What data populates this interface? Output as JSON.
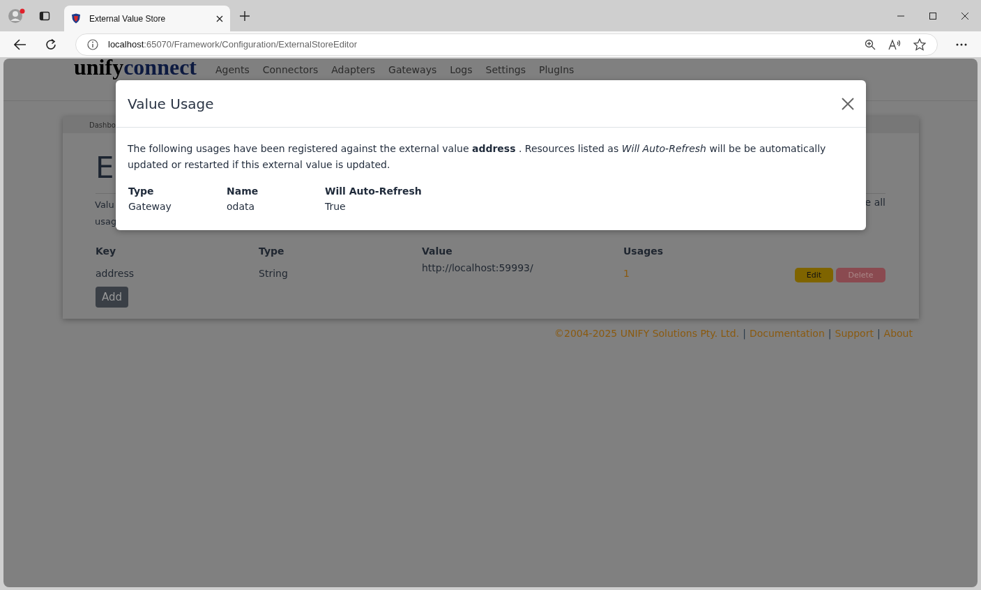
{
  "browser": {
    "tab_title": "External Value Store",
    "address_host": "localhost",
    "address_path": ":65070/Framework/Configuration/ExternalStoreEditor"
  },
  "page": {
    "logo": [
      "unify",
      "connect"
    ],
    "nav": [
      "Agents",
      "Connectors",
      "Adapters",
      "Gateways",
      "Logs",
      "Settings",
      "PlugIns"
    ],
    "breadcrumb": "Dashbo",
    "heading": "E",
    "intro_left": [
      "Valu",
      "usag"
    ],
    "intro_right": "e all",
    "table": {
      "columns": [
        "Key",
        "Type",
        "Value",
        "Usages"
      ],
      "rows": [
        {
          "key": "address",
          "type": "String",
          "value": "http://localhost:59993/",
          "usages": "1",
          "actions": [
            "Edit",
            "Delete"
          ]
        }
      ]
    },
    "add_button": "Add",
    "footer": {
      "copyright": "©2004-2025 UNIFY Solutions Pty. Ltd.",
      "separator": "|",
      "links": [
        "Documentation",
        "Support",
        "About"
      ]
    }
  },
  "modal": {
    "title": "Value Usage",
    "text": "The following usages have been registered against the external value **address** . Resources listed as *Will Auto-Refresh* will be be automatically updated or restarted if this external value is updated.",
    "columns": [
      "Type",
      "Name",
      "Will Auto-Refresh"
    ],
    "rows": [
      [
        "Gateway",
        "odata",
        "True"
      ]
    ]
  }
}
